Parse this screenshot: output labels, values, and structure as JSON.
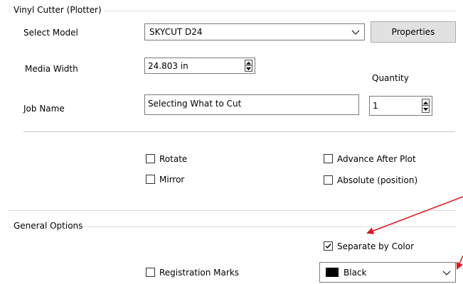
{
  "vinyl_group": {
    "title": "Vinyl Cutter (Plotter)",
    "select_model_label": "Select Model",
    "model_value": "SKYCUT D24",
    "properties_button": "Properties",
    "media_width_label": "Media Width",
    "media_width_value": "24.803 in",
    "quantity_label": "Quantity",
    "quantity_value": "1",
    "job_name_label": "Job Name",
    "job_name_value": "Selecting What to  Cut",
    "checkboxes": {
      "rotate": {
        "label": "Rotate",
        "checked": false
      },
      "mirror": {
        "label": "Mirror",
        "checked": false
      },
      "advance_after_plot": {
        "label": "Advance After Plot",
        "checked": false
      },
      "absolute_position": {
        "label": "Absolute (position)",
        "checked": false
      }
    }
  },
  "general_group": {
    "title": "General Options",
    "separate_by_color": {
      "label": "Separate by Color",
      "checked": true
    },
    "registration_marks": {
      "label": "Registration Marks",
      "checked": false
    },
    "color_select": {
      "value": "Black",
      "swatch_color": "#000000"
    }
  },
  "colors": {
    "annotation_arrow": "#e8141b",
    "border": "#7a7a7a",
    "button_bg": "#e1e1e1"
  }
}
